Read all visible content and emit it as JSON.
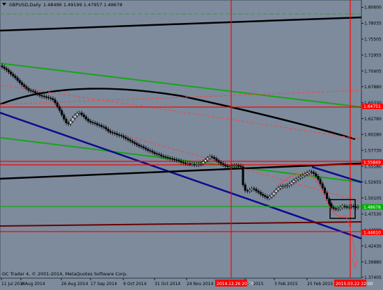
{
  "header": {
    "symbol": "GBPUSD,Daily",
    "ohlc": "1.48496 1.49199 1.47957 1.48678"
  },
  "footer": {
    "copyright": "GC Trader 4, © 2001-2014, MetaQuotes Software Corp."
  },
  "chart_data": {
    "type": "candlestick",
    "symbol": "GBPUSD",
    "timeframe": "Daily",
    "ylim": [
      1.3728,
      1.8175
    ],
    "y_ticks": [
      "1.80600",
      "1.78035",
      "1.75505",
      "1.72955",
      "1.70405",
      "1.67880",
      "1.65330",
      "1.62780",
      "1.60280",
      "1.57730",
      "1.55180",
      "1.52655",
      "1.50105",
      "1.47530",
      "1.44980",
      "1.42430",
      "1.39880",
      "1.37405"
    ],
    "x_ticks": [
      "11 Jul 2014",
      "4 Aug 2014",
      "26 Aug 2014",
      "17 Sep 2014",
      "9 Oct 2014",
      "31 Oct 2014",
      "24 Nov 2014",
      "Jan 2015",
      "3 Feb 2015",
      "25 Feb 2015"
    ],
    "price_tags": [
      {
        "value": 1.64751,
        "label": "1.64751",
        "color": "#ff0000"
      },
      {
        "value": 1.55849,
        "label": "1.55849",
        "color": "#ff0000"
      },
      {
        "value": 1.48678,
        "label": "1.48678",
        "color": "#00b000"
      },
      {
        "value": 1.4461,
        "label": "1.44610",
        "color": "#ff0000"
      }
    ],
    "time_tags": [
      "2014.12.26 20:00",
      "2015.03.22 22:00"
    ],
    "closes": [
      1.7105,
      1.708,
      1.7055,
      1.7025,
      1.699,
      1.696,
      1.693,
      1.689,
      1.6855,
      1.682,
      1.679,
      1.676,
      1.673,
      1.672,
      1.671,
      1.669,
      1.667,
      1.665,
      1.664,
      1.663,
      1.662,
      1.661,
      1.66,
      1.658,
      1.653,
      1.647,
      1.641,
      1.634,
      1.627,
      1.621,
      1.6195,
      1.624,
      1.629,
      1.633,
      1.636,
      1.637,
      1.634,
      1.631,
      1.627,
      1.624,
      1.622,
      1.621,
      1.62,
      1.618,
      1.617,
      1.615,
      1.614,
      1.611,
      1.608,
      1.606,
      1.605,
      1.604,
      1.602,
      1.601,
      1.6,
      1.598,
      1.596,
      1.594,
      1.592,
      1.59,
      1.588,
      1.586,
      1.584,
      1.583,
      1.581,
      1.579,
      1.577,
      1.576,
      1.574,
      1.572,
      1.571,
      1.57,
      1.568,
      1.567,
      1.566,
      1.565,
      1.564,
      1.563,
      1.562,
      1.561,
      1.56,
      1.558,
      1.557,
      1.556,
      1.556,
      1.555,
      1.555,
      1.554,
      1.554,
      1.555,
      1.556,
      1.559,
      1.562,
      1.565,
      1.567,
      1.566,
      1.564,
      1.561,
      1.558,
      1.556,
      1.554,
      1.552,
      1.551,
      1.551,
      1.552,
      1.553,
      1.553,
      1.552,
      1.551,
      1.522,
      1.513,
      1.512,
      1.514,
      1.516,
      1.515,
      1.512,
      1.51,
      1.507,
      1.505,
      1.503,
      1.501,
      1.503,
      1.506,
      1.51,
      1.514,
      1.517,
      1.519,
      1.52,
      1.52,
      1.521,
      1.523,
      1.526,
      1.529,
      1.531,
      1.533,
      1.535,
      1.537,
      1.539,
      1.541,
      1.543,
      1.542,
      1.54,
      1.536,
      1.531,
      1.524,
      1.517,
      1.509,
      1.5,
      1.492,
      1.486,
      1.484,
      1.483,
      1.484,
      1.486,
      1.488,
      1.487,
      1.486,
      1.487,
      1.488,
      1.487,
      1.486,
      1.487
    ]
  }
}
